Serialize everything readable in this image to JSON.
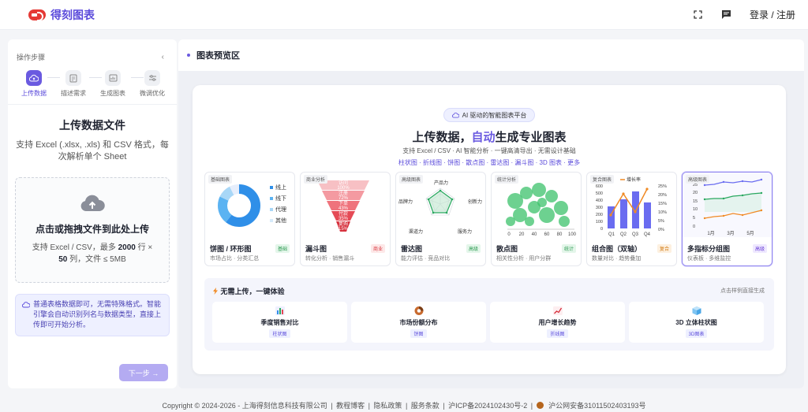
{
  "app": {
    "name": "得刻图表"
  },
  "topbar": {
    "login": "登录 / 注册",
    "fullscreen_icon": "fullscreen-icon",
    "message_icon": "message-icon"
  },
  "sidebar": {
    "steps_title": "操作步骤",
    "steps": [
      {
        "label": "上传数据",
        "icon": "cloud-upload-icon",
        "active": true
      },
      {
        "label": "描述需求",
        "icon": "document-icon",
        "active": false
      },
      {
        "label": "生成图表",
        "icon": "chart-icon",
        "active": false
      },
      {
        "label": "微调优化",
        "icon": "sliders-icon",
        "active": false
      }
    ],
    "upload_title": "上传数据文件",
    "upload_desc": "支持 Excel (.xlsx, .xls) 和 CSV 格式，每次解析单个 Sheet",
    "dropzone": {
      "main": "点击或拖拽文件到此处上传",
      "sub_prefix": "支持 Excel / CSV，最多 ",
      "rows": "2000",
      "sub_mid": " 行 × ",
      "cols": "50",
      "sub_suffix": " 列，文件 ≤ 5MB"
    },
    "tip": "普通表格数据即可，无需特殊格式。智能引擎会自动识别列名与数据类型，直接上传即可开始分析。",
    "next_button": "下一步 →"
  },
  "preview": {
    "title": "图表预览区",
    "badge": "AI 驱动的智能图表平台",
    "hero_prefix": "上传数据，",
    "hero_highlight": "自动",
    "hero_suffix": "生成专业图表",
    "hero_sub": "支持 Excel / CSV · AI 智能分析 · 一键高清导出 · 无需设计基础",
    "hero_links": "柱状图 · 折线图 · 饼图 · 散点图 · 雷达图 · 漏斗图 · 3D 图表 · 更多",
    "cards": [
      {
        "tag": "基础图表",
        "name": "饼图 / 环形图",
        "desc": "市场占比 · 分类汇总",
        "badge": "基础",
        "legend": [
          "线上",
          "线下",
          "代理",
          "其他"
        ]
      },
      {
        "tag": "商业分析",
        "name": "漏斗图",
        "desc": "转化分析 · 销售漏斗",
        "badge": "商业",
        "labels": [
          "访问",
          "100%",
          "注册",
          "72%",
          "下单",
          "43%",
          "付款",
          "35%",
          "复购",
          "15%"
        ]
      },
      {
        "tag": "高级图表",
        "name": "雷达图",
        "desc": "能力评估 · 竞品对比",
        "badge": "高级",
        "axes": [
          "产品力",
          "创新力",
          "服务力",
          "渠道力",
          "品牌力"
        ]
      },
      {
        "tag": "统计分析",
        "name": "散点图",
        "desc": "相关性分析 · 用户分群",
        "badge": "统计",
        "ticks": [
          "0",
          "20",
          "40",
          "60",
          "80",
          "100"
        ]
      },
      {
        "tag": "复合图表",
        "name": "组合图（双轴）",
        "desc": "数量对比 · 趋势叠加",
        "badge": "复合",
        "legend": "增长率",
        "left_ticks": [
          "600",
          "500",
          "400",
          "300",
          "200",
          "100",
          "0"
        ],
        "right_ticks": [
          "25%",
          "20%",
          "15%",
          "10%",
          "5%",
          "0%"
        ],
        "x": [
          "Q1",
          "Q2",
          "Q3",
          "Q4"
        ]
      },
      {
        "tag": "高级图表",
        "name": "多指标分组图",
        "desc": "仪表板 · 多维监控",
        "badge": "高级",
        "left_ticks": [
          "25",
          "20",
          "15",
          "10",
          "5",
          "0"
        ],
        "x": [
          "1月",
          "3月",
          "5月"
        ]
      }
    ],
    "quick": {
      "title": "无需上传，一键体验",
      "hint": "点击样例直接生成",
      "items": [
        {
          "name": "季度销售对比",
          "tag": "柱状图",
          "icon": "bar-chart-icon"
        },
        {
          "name": "市场份额分布",
          "tag": "饼图",
          "icon": "donut-icon"
        },
        {
          "name": "用户增长趋势",
          "tag": "折线图",
          "icon": "line-chart-icon"
        },
        {
          "name": "3D 立体柱状图",
          "tag": "3D图表",
          "icon": "cube-icon"
        }
      ]
    }
  },
  "footer": {
    "copyright": "Copyright © 2024-2026 - 上海得刻信息科技有限公司",
    "links": [
      "教程博客",
      "隐私政策",
      "服务条款"
    ],
    "icp": "沪ICP备2024102430号-2",
    "police": "沪公网安备31011502403193号"
  },
  "colors": {
    "accent": "#6a5ae0",
    "brand_red": "#e53935"
  }
}
